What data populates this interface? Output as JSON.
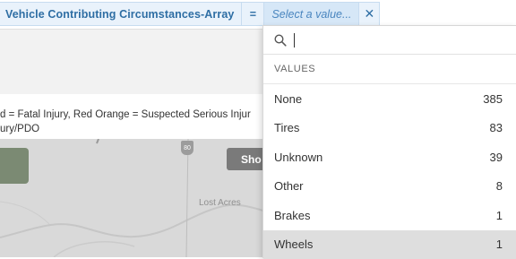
{
  "filter": {
    "field_name": "Vehicle Contributing Circumstances-Array",
    "operator": "=",
    "value_placeholder": "Select a value...",
    "clear_symbol": "✕"
  },
  "legend": {
    "line1": "d = Fatal Injury, Red Orange = Suspected Serious Injur",
    "line2": "ury/PDO"
  },
  "map": {
    "button_label": "Sho",
    "place_label": "Lost Acres",
    "highway_shield": "80"
  },
  "dropdown": {
    "search_value": "",
    "section_title": "VALUES",
    "options": [
      {
        "label": "None",
        "count": "385"
      },
      {
        "label": "Tires",
        "count": "83"
      },
      {
        "label": "Unknown",
        "count": "39"
      },
      {
        "label": "Other",
        "count": "8"
      },
      {
        "label": "Brakes",
        "count": "1"
      },
      {
        "label": "Wheels",
        "count": "1"
      }
    ],
    "hovered_option": "Wheels"
  },
  "colors": {
    "filter_text": "#2e6ea4",
    "filter_bg": "#e9f2fb",
    "hover_bg": "#dedede"
  }
}
